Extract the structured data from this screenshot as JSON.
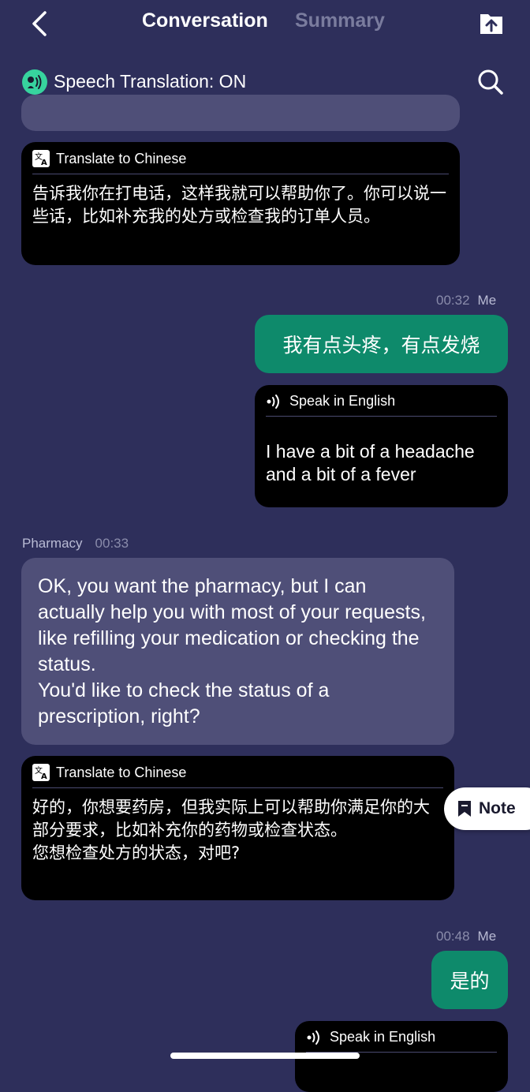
{
  "header": {
    "tab_conversation": "Conversation",
    "tab_summary": "Summary"
  },
  "speech_translation": {
    "label": "Speech Translation: ON"
  },
  "colors": {
    "background": "#2e2f5b",
    "accent_green": "#0e8a6b",
    "status_green": "#37d39e",
    "incoming_bubble": "#4f4f78",
    "translation_bubble": "#000000"
  },
  "messages": {
    "m1_translation": {
      "header": "Translate to Chinese",
      "text": "告诉我你在打电话，这样我就可以帮助你了。你可以说一些话，比如补充我的处方或检查我的订单人员。"
    },
    "m2": {
      "time": "00:32",
      "sender": "Me",
      "text": "我有点头疼，有点发烧"
    },
    "m2_translation": {
      "header": "Speak in English",
      "text": "I have a bit of a headache and a bit of a fever"
    },
    "m3": {
      "sender": "Pharmacy",
      "time": "00:33",
      "text_line1": "OK, you want the pharmacy, but I can actually help you with most of your requests, like refilling your medication or checking the status.",
      "text_line2": "You'd like to check the status of a prescription, right?"
    },
    "m3_translation": {
      "header": "Translate to Chinese",
      "text_line1": "好的，你想要药房，但我实际上可以帮助你满足你的大部分要求，比如补充你的药物或检查状态。",
      "text_line2": "您想检查处方的状态，对吧?"
    },
    "m4": {
      "time": "00:48",
      "sender": "Me",
      "text": "是的"
    },
    "m4_translation": {
      "header": "Speak in English"
    }
  },
  "note_button": {
    "label": "Note"
  }
}
